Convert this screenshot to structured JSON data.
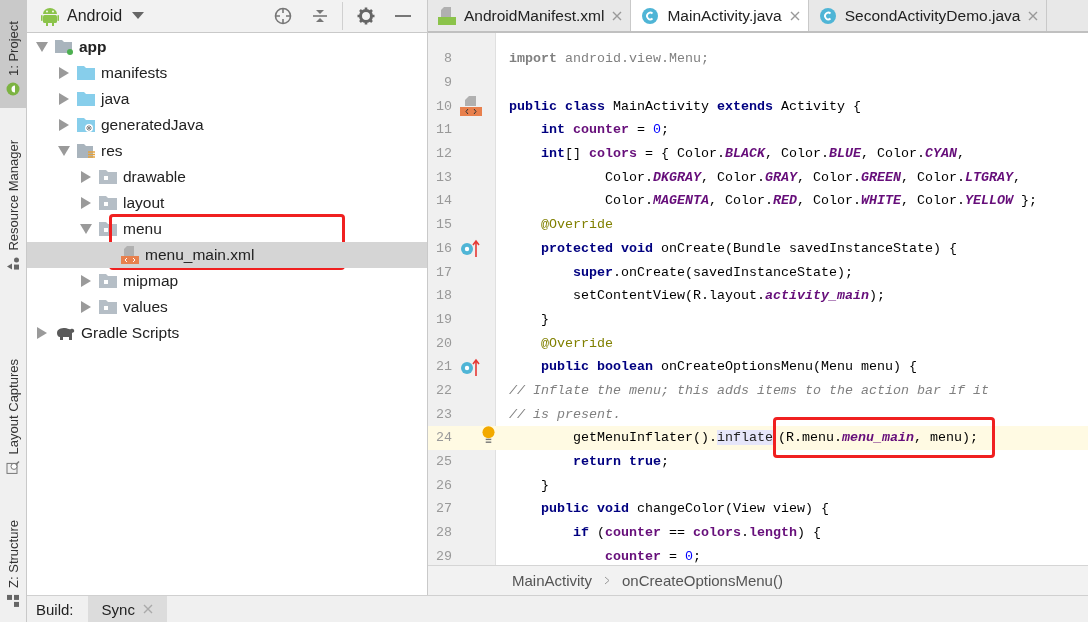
{
  "tool_strip": [
    {
      "label": "1: Project",
      "kind": "android",
      "selected": true
    },
    {
      "label": "Resource Manager",
      "kind": "shapes",
      "selected": false
    },
    {
      "label": "Layout Captures",
      "kind": "capture",
      "selected": false
    },
    {
      "label": "Z: Structure",
      "kind": "structure",
      "selected": false
    }
  ],
  "project_panel": {
    "view": "Android"
  },
  "tree": {
    "items": [
      {
        "label": "app",
        "kind": "module",
        "expanded": true,
        "selected": false,
        "boxed": false,
        "children": [
          {
            "label": "manifests",
            "kind": "folder-blue",
            "expanded": false,
            "selected": false,
            "boxed": false
          },
          {
            "label": "java",
            "kind": "folder-blue",
            "expanded": false,
            "selected": false,
            "boxed": false
          },
          {
            "label": "generatedJava",
            "kind": "folder-gen",
            "expanded": false,
            "selected": false,
            "boxed": false
          },
          {
            "label": "res",
            "kind": "folder-res",
            "expanded": true,
            "selected": false,
            "boxed": false,
            "children": [
              {
                "label": "drawable",
                "kind": "folder",
                "expanded": false,
                "selected": false,
                "boxed": false
              },
              {
                "label": "layout",
                "kind": "folder",
                "expanded": false,
                "selected": false,
                "boxed": false
              },
              {
                "label": "menu",
                "kind": "folder",
                "expanded": true,
                "selected": false,
                "boxed": true,
                "children": [
                  {
                    "label": "menu_main.xml",
                    "kind": "xml-file",
                    "selected": true,
                    "boxed": false
                  }
                ]
              },
              {
                "label": "mipmap",
                "kind": "folder",
                "expanded": false,
                "selected": false,
                "boxed": false
              },
              {
                "label": "values",
                "kind": "folder",
                "expanded": false,
                "selected": false,
                "boxed": false
              }
            ]
          }
        ]
      },
      {
        "label": "Gradle Scripts",
        "kind": "gradle",
        "expanded": false,
        "selected": false,
        "boxed": false
      }
    ]
  },
  "editor_tabs": [
    {
      "label": "AndroidManifest.xml",
      "kind": "manifest",
      "selected": false
    },
    {
      "label": "MainActivity.java",
      "kind": "java",
      "selected": true
    },
    {
      "label": "SecondActivityDemo.java",
      "kind": "java",
      "selected": false
    }
  ],
  "code": [
    {
      "number": "8",
      "kind": "plain",
      "current": false,
      "tokens": [
        {
          "kind": "unused-kw",
          "text": "import"
        },
        {
          "kind": "unused",
          "text": " android.view.Menu;"
        }
      ]
    },
    {
      "number": "9",
      "kind": "plain",
      "current": false
    },
    {
      "number": "10",
      "kind": "class",
      "current": false,
      "tokens": [
        {
          "kind": "kw",
          "text": "public class"
        },
        {
          "kind": "plain",
          "text": " MainActivity "
        },
        {
          "kind": "kw",
          "text": "extends"
        },
        {
          "kind": "plain",
          "text": " Activity {"
        }
      ]
    },
    {
      "number": "11",
      "kind": "plain",
      "current": false,
      "tokens": [
        {
          "kind": "kw",
          "text": "    int"
        },
        {
          "kind": "field",
          "text": " counter"
        },
        {
          "kind": "plain",
          "text": " = "
        },
        {
          "kind": "num",
          "text": "0"
        },
        {
          "kind": "plain",
          "text": ";"
        }
      ]
    },
    {
      "number": "12",
      "kind": "plain",
      "current": false,
      "tokens": [
        {
          "kind": "kw",
          "text": "    int"
        },
        {
          "kind": "plain",
          "text": "[] "
        },
        {
          "kind": "field",
          "text": "colors"
        },
        {
          "kind": "plain",
          "text": " = { Color."
        },
        {
          "kind": "const",
          "text": "BLACK"
        },
        {
          "kind": "plain",
          "text": ", Color."
        },
        {
          "kind": "const",
          "text": "BLUE"
        },
        {
          "kind": "plain",
          "text": ", Color."
        },
        {
          "kind": "const",
          "text": "CYAN"
        },
        {
          "kind": "plain",
          "text": ","
        }
      ]
    },
    {
      "number": "13",
      "kind": "plain",
      "current": false,
      "tokens": [
        {
          "kind": "plain",
          "text": "            Color."
        },
        {
          "kind": "const",
          "text": "DKGRAY"
        },
        {
          "kind": "plain",
          "text": ", Color."
        },
        {
          "kind": "const",
          "text": "GRAY"
        },
        {
          "kind": "plain",
          "text": ", Color."
        },
        {
          "kind": "const",
          "text": "GREEN"
        },
        {
          "kind": "plain",
          "text": ", Color."
        },
        {
          "kind": "const",
          "text": "LTGRAY"
        },
        {
          "kind": "plain",
          "text": ","
        }
      ]
    },
    {
      "number": "14",
      "kind": "plain",
      "current": false,
      "tokens": [
        {
          "kind": "plain",
          "text": "            Color."
        },
        {
          "kind": "const",
          "text": "MAGENTA"
        },
        {
          "kind": "plain",
          "text": ", Color."
        },
        {
          "kind": "const",
          "text": "RED"
        },
        {
          "kind": "plain",
          "text": ", Color."
        },
        {
          "kind": "const",
          "text": "WHITE"
        },
        {
          "kind": "plain",
          "text": ", Color."
        },
        {
          "kind": "const",
          "text": "YELLOW"
        },
        {
          "kind": "plain",
          "text": " };"
        }
      ]
    },
    {
      "number": "15",
      "kind": "plain",
      "current": false,
      "tokens": [
        {
          "kind": "annot",
          "text": "    @Override"
        }
      ]
    },
    {
      "number": "16",
      "kind": "override",
      "current": false,
      "tokens": [
        {
          "kind": "kw",
          "text": "    protected void"
        },
        {
          "kind": "plain",
          "text": " onCreate(Bundle savedInstanceState) {"
        }
      ]
    },
    {
      "number": "17",
      "kind": "plain",
      "current": false,
      "tokens": [
        {
          "kind": "kw",
          "text": "        super"
        },
        {
          "kind": "plain",
          "text": ".onCreate(savedInstanceState);"
        }
      ]
    },
    {
      "number": "18",
      "kind": "plain",
      "current": false,
      "tokens": [
        {
          "kind": "plain",
          "text": "        setContentView(R.layout."
        },
        {
          "kind": "const",
          "text": "activity_main"
        },
        {
          "kind": "plain",
          "text": ");"
        }
      ]
    },
    {
      "number": "19",
      "kind": "plain",
      "current": false,
      "tokens": [
        {
          "kind": "plain",
          "text": "    }"
        }
      ]
    },
    {
      "number": "20",
      "kind": "plain",
      "current": false,
      "tokens": [
        {
          "kind": "annot",
          "text": "    @Override"
        }
      ]
    },
    {
      "number": "21",
      "kind": "override",
      "current": false,
      "tokens": [
        {
          "kind": "kw",
          "text": "    public boolean"
        },
        {
          "kind": "plain",
          "text": " onCreateOptionsMenu(Menu menu) {"
        }
      ]
    },
    {
      "number": "22",
      "kind": "plain",
      "current": false,
      "tokens": [
        {
          "kind": "comment",
          "text": "// Inflate the menu; this adds items to the action bar if it"
        }
      ]
    },
    {
      "number": "23",
      "kind": "plain",
      "current": false,
      "tokens": [
        {
          "kind": "comment",
          "text": "// is present."
        }
      ]
    },
    {
      "number": "24",
      "kind": "intention",
      "current": true,
      "tokens": [
        {
          "kind": "plain",
          "text": "        getMenuInflater()."
        },
        {
          "kind": "usage",
          "text": "inflate"
        }
      ],
      "boxed_tokens": [
        {
          "kind": "plain",
          "text": "(R.menu."
        },
        {
          "kind": "const",
          "text": "menu_main"
        },
        {
          "kind": "plain",
          "text": ", menu);"
        }
      ]
    },
    {
      "number": "25",
      "kind": "plain",
      "current": false,
      "tokens": [
        {
          "kind": "kw",
          "text": "        return true"
        },
        {
          "kind": "plain",
          "text": ";"
        }
      ]
    },
    {
      "number": "26",
      "kind": "plain",
      "current": false,
      "tokens": [
        {
          "kind": "plain",
          "text": "    }"
        }
      ]
    },
    {
      "number": "27",
      "kind": "plain",
      "current": false,
      "tokens": [
        {
          "kind": "kw",
          "text": "    public void"
        },
        {
          "kind": "plain",
          "text": " changeColor(View view) {"
        }
      ]
    },
    {
      "number": "28",
      "kind": "plain",
      "current": false,
      "tokens": [
        {
          "kind": "kw",
          "text": "        if"
        },
        {
          "kind": "plain",
          "text": " ("
        },
        {
          "kind": "field",
          "text": "counter"
        },
        {
          "kind": "plain",
          "text": " == "
        },
        {
          "kind": "field",
          "text": "colors"
        },
        {
          "kind": "plain",
          "text": "."
        },
        {
          "kind": "field",
          "text": "length"
        },
        {
          "kind": "plain",
          "text": ") {"
        }
      ]
    },
    {
      "number": "29",
      "kind": "plain",
      "current": false,
      "tokens": [
        {
          "kind": "field",
          "text": "            counter"
        },
        {
          "kind": "plain",
          "text": " = "
        },
        {
          "kind": "num",
          "text": "0"
        },
        {
          "kind": "plain",
          "text": ";"
        }
      ]
    }
  ],
  "breadcrumb": [
    "MainActivity",
    "onCreateOptionsMenu()"
  ],
  "bottom_bar": {
    "label": "Build:",
    "tabs": [
      {
        "label": "Sync",
        "selected": true
      }
    ]
  }
}
